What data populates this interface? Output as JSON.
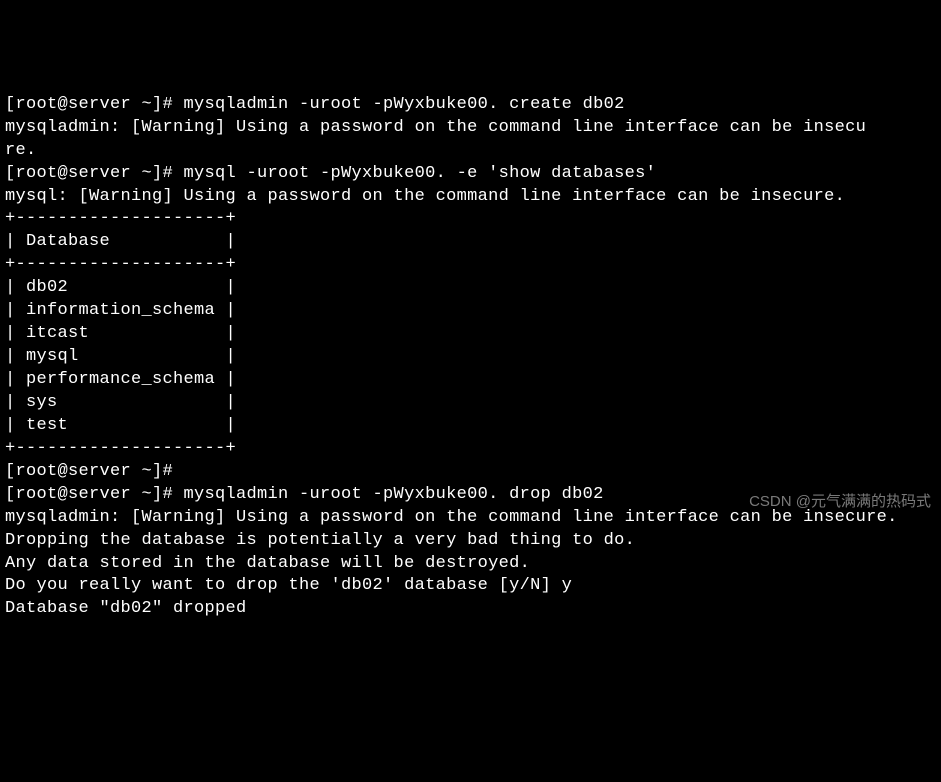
{
  "lines": {
    "l0": "[root@server ~]# mysqladmin -uroot -pWyxbuke00. create db02",
    "l1": "mysqladmin: [Warning] Using a password on the command line interface can be insecu",
    "l2": "re.",
    "l3": "[root@server ~]# mysql -uroot -pWyxbuke00. -e 'show databases'",
    "l4": "mysql: [Warning] Using a password on the command line interface can be insecure.",
    "l5": "+--------------------+",
    "l6": "| Database           |",
    "l7": "+--------------------+",
    "l8": "| db02               |",
    "l9": "| information_schema |",
    "l10": "| itcast             |",
    "l11": "| mysql              |",
    "l12": "| performance_schema |",
    "l13": "| sys                |",
    "l14": "| test               |",
    "l15": "+--------------------+",
    "l16": "[root@server ~]#",
    "l17": "[root@server ~]# mysqladmin -uroot -pWyxbuke00. drop db02",
    "l18": "mysqladmin: [Warning] Using a password on the command line interface can be insecure.",
    "l19": "Dropping the database is potentially a very bad thing to do.",
    "l20": "Any data stored in the database will be destroyed.",
    "l21": "",
    "l22": "Do you really want to drop the 'db02' database [y/N] y",
    "l23": "Database \"db02\" dropped"
  },
  "watermark": "CSDN @元气满满的热码式"
}
